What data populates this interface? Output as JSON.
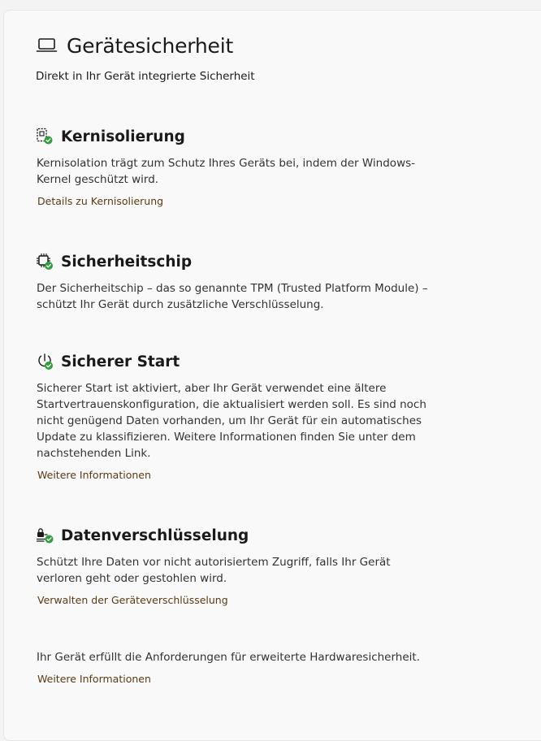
{
  "header": {
    "title": "Gerätesicherheit",
    "icon": "laptop-icon",
    "subtitle": "Direkt in Ihr Gerät integrierte Sicherheit"
  },
  "sections": [
    {
      "icon": "core-isolation-icon",
      "title": "Kernisolierung",
      "description": "Kernisolation trägt zum Schutz Ihres Geräts bei, indem der Windows-Kernel geschützt wird.",
      "link": "Details zu Kernisolierung"
    },
    {
      "icon": "security-chip-icon",
      "title": "Sicherheitschip",
      "description": "Der Sicherheitschip – das so genannte TPM (Trusted Platform Module) – schützt Ihr Gerät durch zusätzliche Verschlüsselung."
    },
    {
      "icon": "secure-boot-icon",
      "title": "Sicherer Start",
      "description": "Sicherer Start ist aktiviert, aber Ihr Gerät verwendet eine ältere Startvertrauenskonfiguration, die aktualisiert werden soll. Es sind noch nicht genügend Daten vorhanden, um Ihr Gerät für ein automatisches Update zu klassifizieren. Weitere Informationen finden Sie unter dem nachstehenden Link.",
      "link": "Weitere Informationen"
    },
    {
      "icon": "data-encryption-icon",
      "title": "Datenverschlüsselung",
      "description": "Schützt Ihre Daten vor nicht autorisiertem Zugriff, falls Ihr Gerät verloren geht oder gestohlen wird.",
      "link": "Verwalten der Geräteverschlüsselung"
    }
  ],
  "footer": {
    "text": "Ihr Gerät erfüllt die Anforderungen für erweiterte Hardwaresicherheit.",
    "link": "Weitere Informationen"
  },
  "colors": {
    "status_ok": "#2e9e3e",
    "link": "#5a3a12"
  }
}
